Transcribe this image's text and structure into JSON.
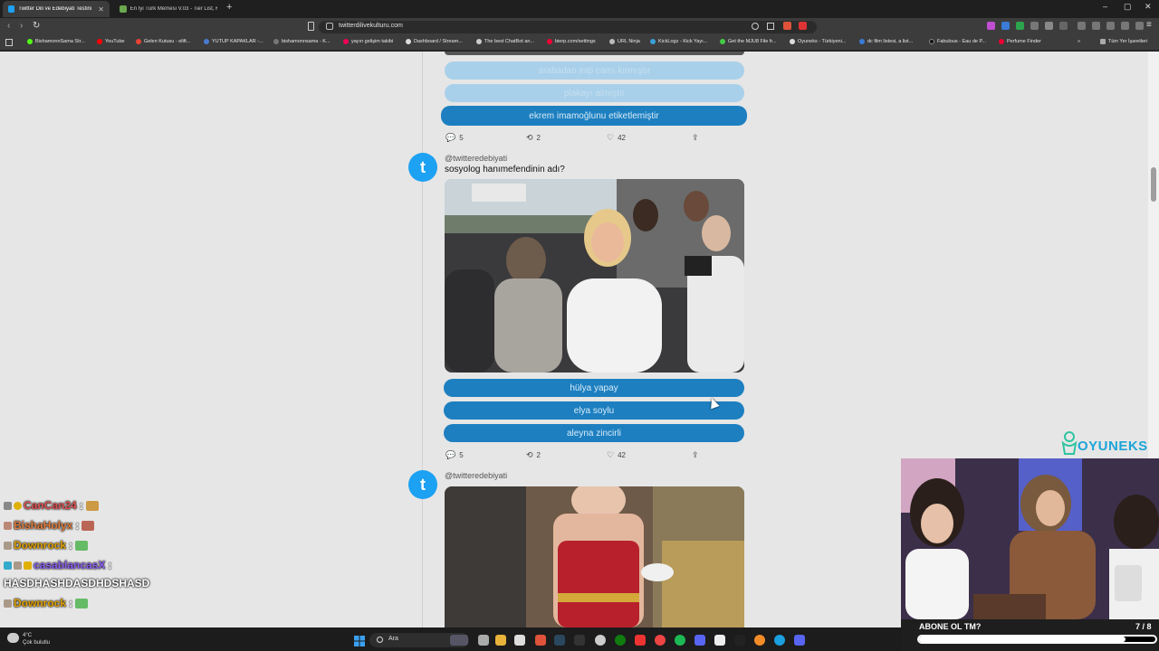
{
  "browser": {
    "tabs": [
      {
        "label": "Twitter Dili ve Edebiyatı Testini Y...",
        "active": true
      },
      {
        "label": "En İyi Türk Memesi V.03 - Tier List, Ki...",
        "active": false
      }
    ],
    "new_tab": "+",
    "window_controls": [
      "–",
      "▢",
      "✕"
    ],
    "url": "twitterdilivekulturu.com",
    "bookmarks": [
      "BishamonnSama Str...",
      "YouTube",
      "Gelen Kutusu - elift...",
      "YUTUP KAPAKLAR -...",
      "bishamonnsama - K...",
      "yayın gelişim takibi",
      "Dashboard / Stream...",
      "The best ChatBot an...",
      "bierp.com/settings",
      "URL Ninja",
      "KickLogz - Kick Yayı...",
      "Get the MJU8 File fr...",
      "Oyuneks - Türkiyeni...",
      "dc film listesi, a list...",
      "Fabulous - Eau de P...",
      "Perfume Finder"
    ],
    "bookmarks_overflow": "»",
    "all_bookmarks": "Tüm Yer İşaretleri"
  },
  "feed": {
    "prev_post": {
      "options": [
        "arabadan inip camı kırmıştır",
        "plakayı almıştır",
        "ekrem imamoğlunu etiketlemiştir"
      ],
      "stats": {
        "replies": "5",
        "retweets": "2",
        "likes": "42"
      }
    },
    "post1": {
      "handle": "@twitteredebiyati",
      "text": "sosyolog hanımefendinin adı?",
      "options": [
        "hülya yapay",
        "elya soylu",
        "aleyna zincirli"
      ],
      "stats": {
        "replies": "5",
        "retweets": "2",
        "likes": "42"
      }
    },
    "post2": {
      "handle": "@twitteredebiyati"
    }
  },
  "chat": [
    {
      "user": "CanCan24",
      "sep": ":",
      "color": "#e05050"
    },
    {
      "user": "BishaHolyx",
      "sep": ":",
      "color": "#e07b3a"
    },
    {
      "user": "Downrock",
      "sep": ":",
      "color": "#e0a000"
    },
    {
      "user": "casablancasX",
      "sep": ":",
      "color": "#8a5cf0"
    },
    {
      "message": "HASDHASHDASDHDSHASD",
      "color": "#ffffff"
    },
    {
      "user": "Downrock",
      "sep": ":",
      "color": "#e0a000"
    }
  ],
  "overlay": {
    "brand": "OYUNEKS",
    "subscribe_prompt": "ABONE OL TM?",
    "sub_count": "7 / 8",
    "sub_progress": 0.875
  },
  "taskbar": {
    "weather_temp": "4°C",
    "weather_desc": "Çok bulutlu",
    "search_placeholder": "Ara"
  },
  "colors": {
    "accent": "#1d7fc0",
    "faded_option": "#a9d0ea",
    "twitter_blue": "#1da1f2"
  }
}
